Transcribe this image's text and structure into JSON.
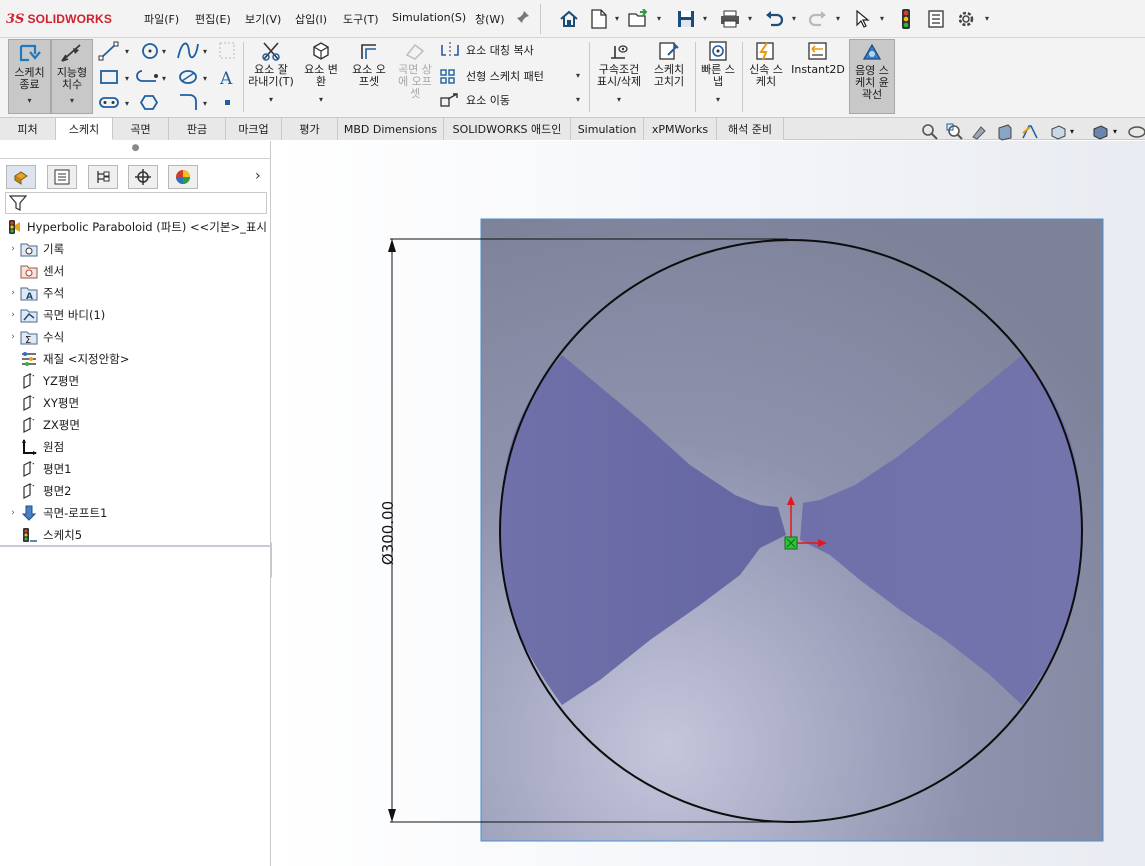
{
  "app": {
    "logo_ds": "3S",
    "logo_text": "SOLIDWORKS"
  },
  "menu": {
    "items": [
      "파일(F)",
      "편집(E)",
      "보기(V)",
      "삽입(I)",
      "도구(T)",
      "Simulation(S)",
      "창(W)"
    ]
  },
  "quick_access": {
    "icons": [
      "home-icon",
      "new-document-icon",
      "open-icon",
      "save-icon",
      "print-icon",
      "undo-icon",
      "redo-icon",
      "select-icon",
      "rebuild-icon",
      "file-properties-icon",
      "options-gear-icon"
    ]
  },
  "command_manager": {
    "sketch_exit": "스케치\n종료",
    "smart_dimension": "지능형\n치수",
    "trim": "요소 잘\n라내기(T)",
    "convert": "요소 변\n환",
    "offset": "요소 오\n프셋",
    "surface_offset": "곡면 상\n에 오프\n셋",
    "mirror": "요소 대칭 복사",
    "linear_pattern": "선형 스케치 패턴",
    "move": "요소 이동",
    "relations": "구속조건\n표시/삭제",
    "repair": "스케치\n고치기",
    "quick_snaps": "빠른 스\n냅",
    "rapid_sketch": "신속 스\n케치",
    "instant2d": "Instant2D",
    "shaded_contours": "음영 스\n케치 윤\n곽선"
  },
  "tabs": [
    "피처",
    "스케치",
    "곡면",
    "판금",
    "마크업",
    "평가",
    "MBD Dimensions",
    "SOLIDWORKS 애드인",
    "Simulation",
    "xPMWorks",
    "해석 준비"
  ],
  "active_tab": "스케치",
  "tree": {
    "root": "Hyperbolic Paraboloid (파트) <<기본>_표시",
    "items": [
      {
        "label": "기록",
        "expandable": true,
        "icon": "history-folder-icon"
      },
      {
        "label": "센서",
        "expandable": false,
        "icon": "sensor-icon"
      },
      {
        "label": "주석",
        "expandable": true,
        "icon": "annotations-icon"
      },
      {
        "label": "곡면 바디(1)",
        "expandable": true,
        "icon": "surface-bodies-icon"
      },
      {
        "label": "수식",
        "expandable": true,
        "icon": "equations-icon"
      },
      {
        "label": "재질 <지정안함>",
        "expandable": false,
        "icon": "material-icon"
      },
      {
        "label": "YZ평면",
        "expandable": false,
        "icon": "plane-icon"
      },
      {
        "label": "XY평면",
        "expandable": false,
        "icon": "plane-icon"
      },
      {
        "label": "ZX평면",
        "expandable": false,
        "icon": "plane-icon"
      },
      {
        "label": "원점",
        "expandable": false,
        "icon": "origin-icon"
      },
      {
        "label": "평면1",
        "expandable": false,
        "icon": "plane-icon"
      },
      {
        "label": "평면2",
        "expandable": false,
        "icon": "plane-icon"
      },
      {
        "label": "곡면-로프트1",
        "expandable": true,
        "icon": "loft-surface-icon"
      },
      {
        "label": "스케치5",
        "expandable": false,
        "icon": "sketch-icon"
      }
    ]
  },
  "dimension": {
    "label": "Ø300.00"
  },
  "colors": {
    "accent_red": "#d0202d",
    "surface_blue": "#6a6aa6",
    "plane_gray": "#8a8ea8",
    "origin_green": "#2ec43a"
  }
}
